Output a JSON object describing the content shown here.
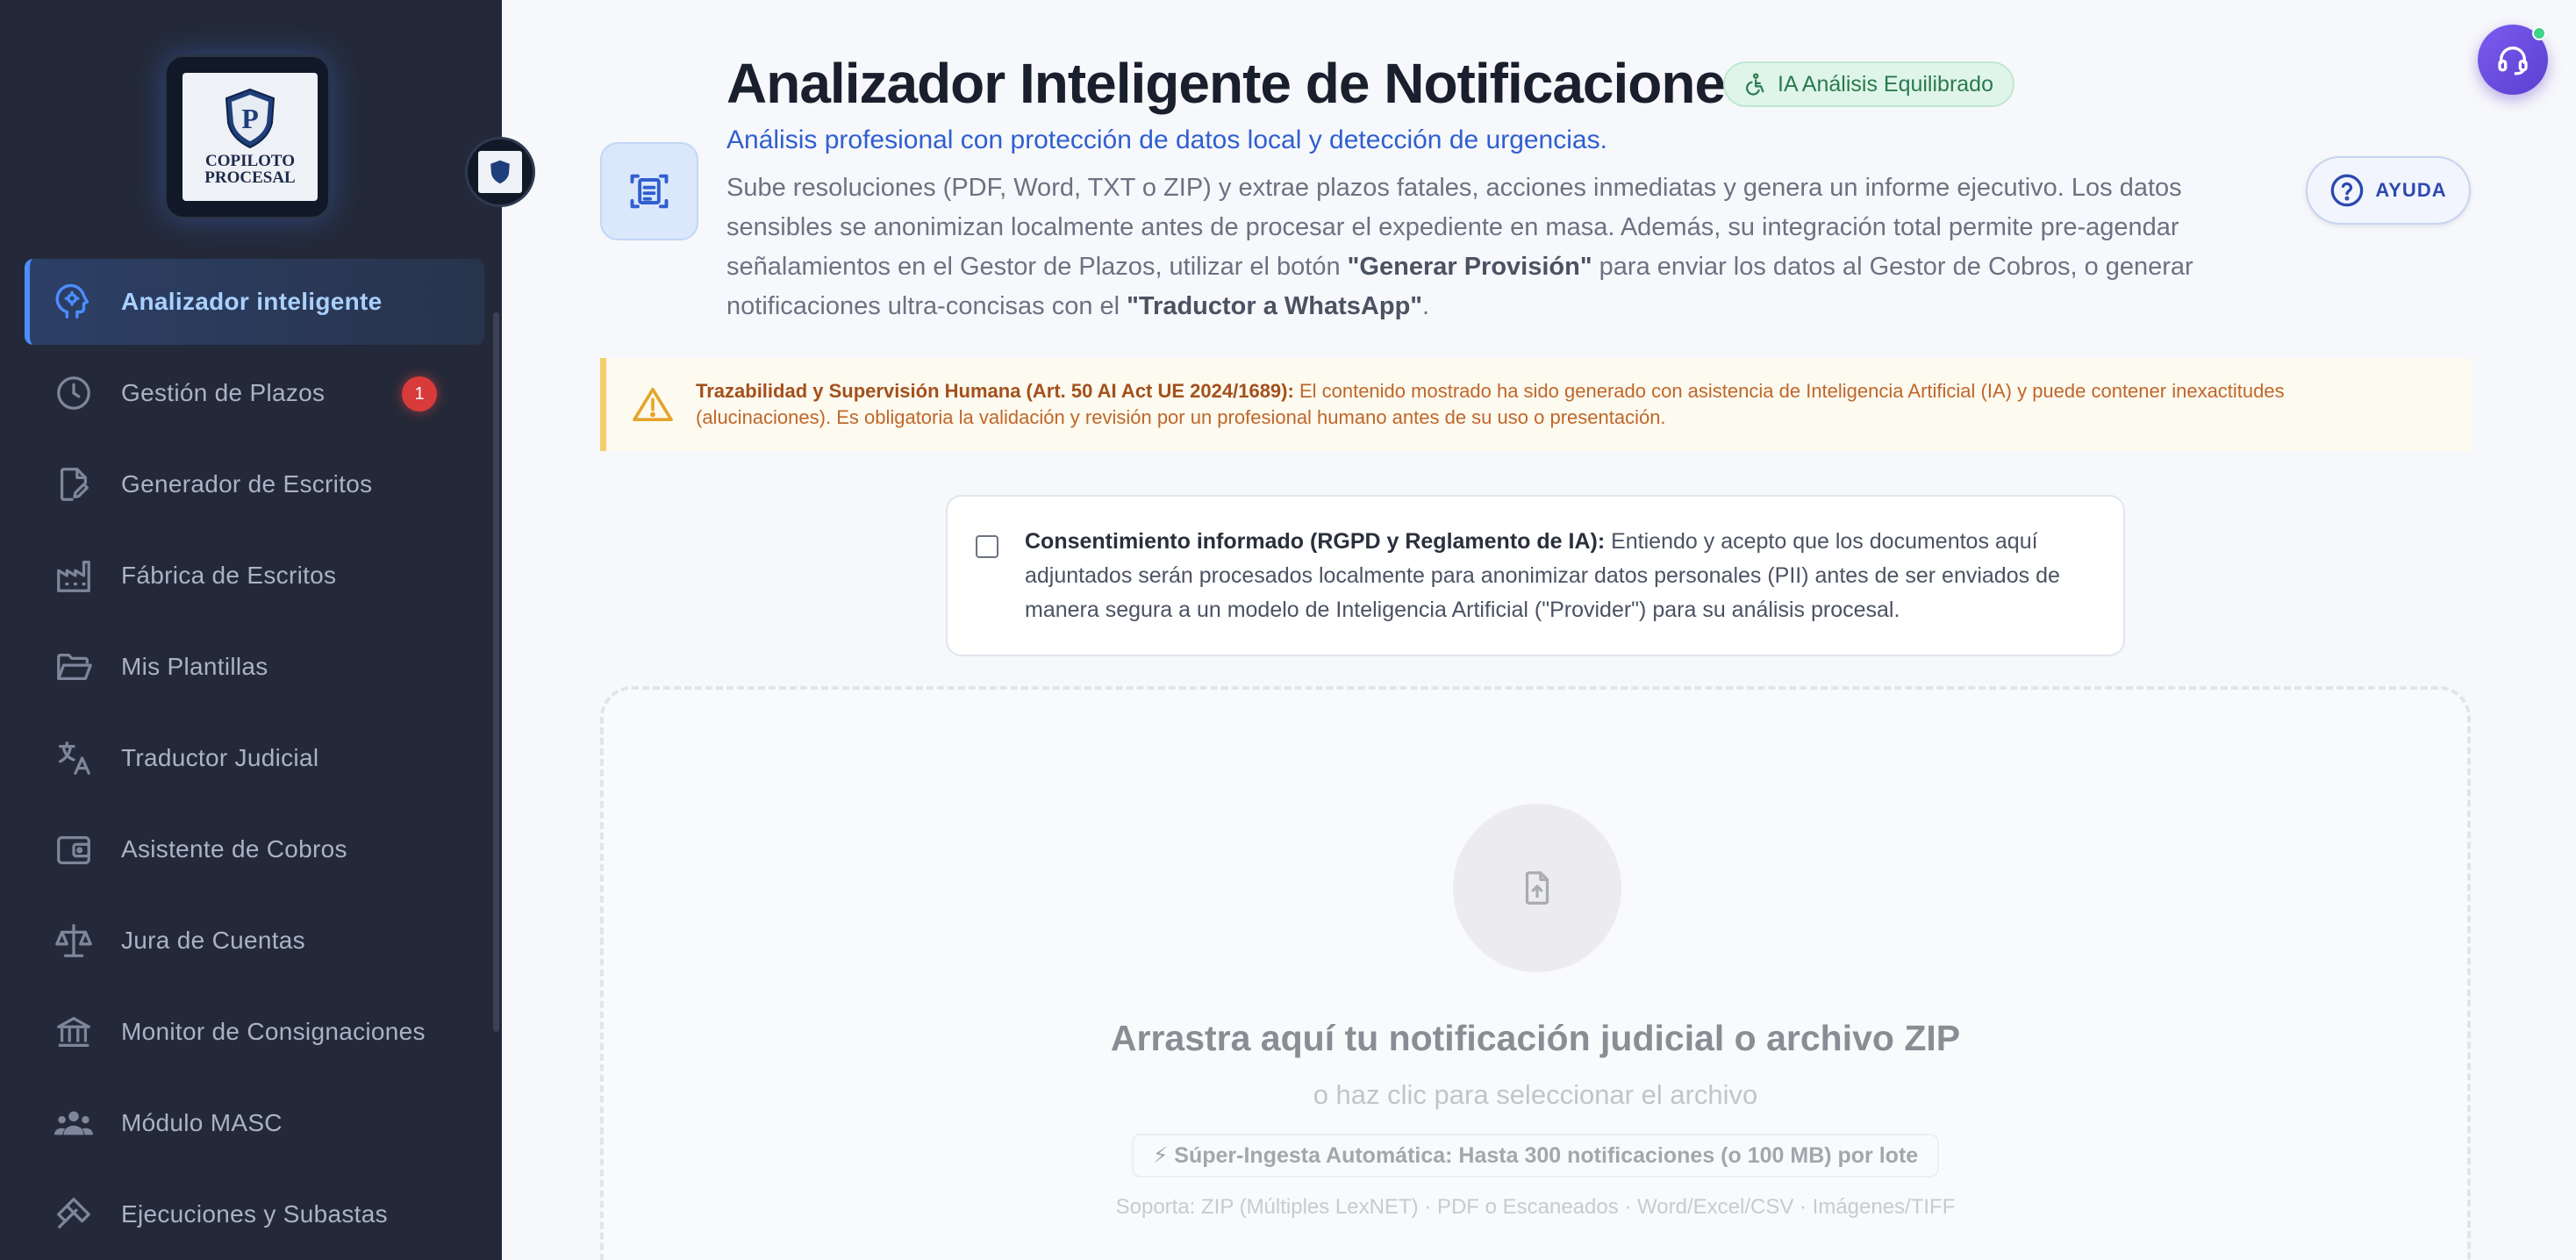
{
  "sidebar": {
    "logo_text": "COPILOTO PROCESAL",
    "items": [
      {
        "label": "Analizador inteligente",
        "icon": "brain-gear-icon",
        "active": true
      },
      {
        "label": "Gestión de Plazos",
        "icon": "clock-icon",
        "badge": "1"
      },
      {
        "label": "Generador de Escritos",
        "icon": "document-edit-icon"
      },
      {
        "label": "Fábrica de Escritos",
        "icon": "factory-icon"
      },
      {
        "label": "Mis Plantillas",
        "icon": "folder-open-icon"
      },
      {
        "label": "Traductor Judicial",
        "icon": "translate-icon"
      },
      {
        "label": "Asistente de Cobros",
        "icon": "wallet-icon"
      },
      {
        "label": "Jura de Cuentas",
        "icon": "scale-icon"
      },
      {
        "label": "Monitor de Consignaciones",
        "icon": "bank-icon"
      },
      {
        "label": "Módulo MASC",
        "icon": "people-icon"
      },
      {
        "label": "Ejecuciones y Subastas",
        "icon": "gavel-hammer-icon"
      }
    ]
  },
  "header": {
    "title": "Analizador Inteligente de Notificaciones",
    "chip": "IA Análisis Equilibrado",
    "subtitle": "Análisis profesional con protección de datos local y detección de urgencias.",
    "desc_1": "Sube resoluciones (PDF, Word, TXT o ZIP) y extrae plazos fatales, acciones inmediatas y genera un informe ejecutivo. Los datos sensibles se anonimizan localmente antes de procesar el expediente en masa. Además, su integración total permite pre-agendar señalamientos en el Gestor de Plazos, utilizar el botón ",
    "desc_bold_1": "\"Generar Provisión\"",
    "desc_2": " para enviar los datos al Gestor de Cobros, o generar notificaciones ultra-concisas con el ",
    "desc_bold_2": "\"Traductor a WhatsApp\"",
    "desc_3": ".",
    "help_label": "AYUDA"
  },
  "warning": {
    "bold": "Trazabilidad y Supervisión Humana (Art. 50 AI Act UE 2024/1689):",
    "text": " El contenido mostrado ha sido generado con asistencia de Inteligencia Artificial (IA) y puede contener inexactitudes (alucinaciones). Es obligatoria la validación y revisión por un profesional humano antes de su uso o presentación."
  },
  "consent": {
    "checked": false,
    "bold": "Consentimiento informado (RGPD y Reglamento de IA):",
    "text": " Entiendo y acepto que los documentos aquí adjuntados serán procesados localmente para anonimizar datos personales (PII) antes de ser enviados de manera segura a un modelo de Inteligencia Artificial (\"Provider\") para su análisis procesal."
  },
  "dropzone": {
    "title": "Arrastra aquí tu notificación judicial o archivo ZIP",
    "subtitle": "o haz clic para seleccionar el archivo",
    "chip": "⚡ Súper-Ingesta Automática: Hasta 300 notificaciones (o 100 MB) por lote",
    "support": "Soporta: ZIP (Múltiples LexNET) · PDF o Escaneados · Word/Excel/CSV · Imágenes/TIFF"
  },
  "colors": {
    "sidebar_bg": "#232938",
    "accent": "#4c8dff",
    "badge": "#d93b3b",
    "chip_green": "#2a7a4e",
    "warning_text": "#c0662a"
  }
}
